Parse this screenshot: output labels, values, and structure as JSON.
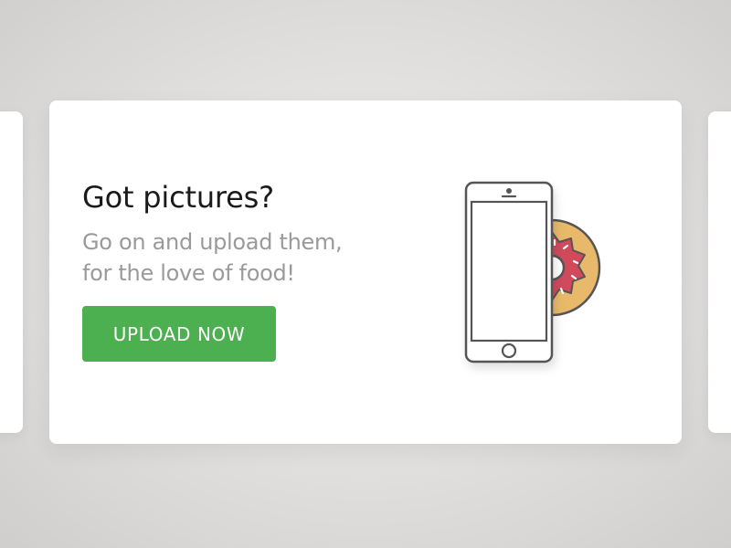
{
  "promo": {
    "title": "Got pictures?",
    "subtitle_line1": "Go on and upload them,",
    "subtitle_line2": "for the love of food!",
    "upload_button_label": "UPLOAD NOW"
  },
  "illustration": {
    "icons": [
      "smartphone-icon",
      "donut-icon"
    ],
    "colors": {
      "outline": "#555555",
      "donut_dough": "#e8b96b",
      "donut_frosting": "#d04a5c",
      "sprinkles": "#ffffff"
    }
  },
  "colors": {
    "accent_green": "#4cb050",
    "title_text": "#1a1a1a",
    "subtitle_text": "#9a9a9a",
    "card_background": "#ffffff"
  }
}
